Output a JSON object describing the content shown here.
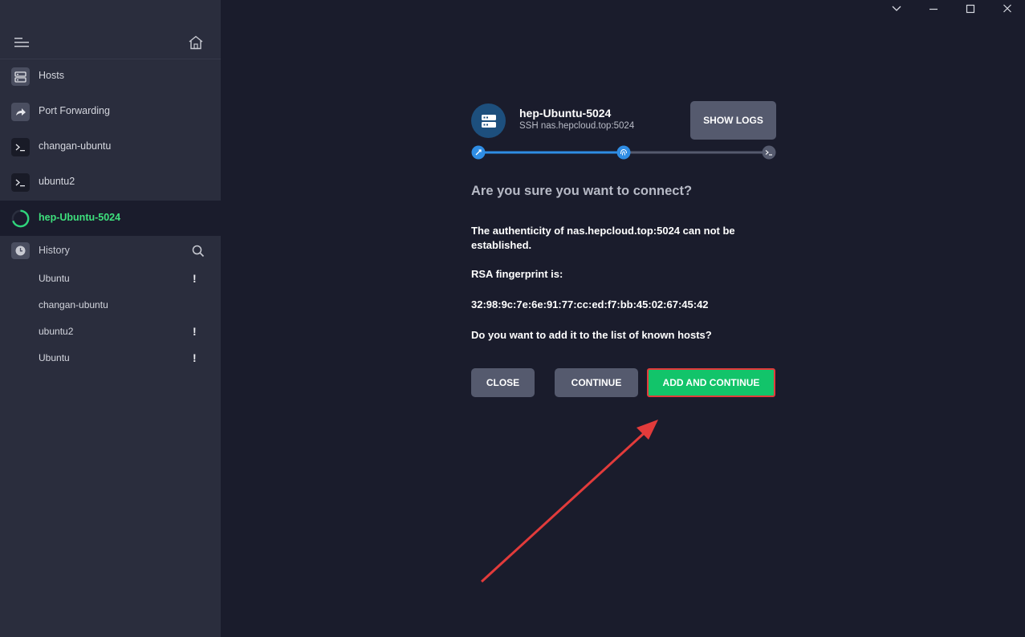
{
  "window": {
    "controls": [
      "chevron-down",
      "minimize",
      "maximize",
      "close"
    ]
  },
  "sidebar": {
    "nav": [
      {
        "label": "Hosts",
        "icon": "hosts-icon"
      },
      {
        "label": "Port Forwarding",
        "icon": "port-forwarding-icon"
      },
      {
        "label": "changan-ubuntu",
        "icon": "terminal-icon"
      },
      {
        "label": "ubuntu2",
        "icon": "terminal-icon"
      },
      {
        "label": "hep-Ubuntu-5024",
        "icon": "connecting-spinner-icon",
        "active": true
      }
    ],
    "history": {
      "label": "History",
      "items": [
        {
          "label": "Ubuntu",
          "warning": "!"
        },
        {
          "label": "changan-ubuntu",
          "warning": ""
        },
        {
          "label": "ubuntu2",
          "warning": "!"
        },
        {
          "label": "Ubuntu",
          "warning": "!"
        }
      ]
    }
  },
  "connection": {
    "host_name": "hep-Ubuntu-5024",
    "host_sub": "SSH nas.hepcloud.top:5024",
    "show_logs": "SHOW LOGS",
    "progress_completed_fraction": 0.5,
    "steps": [
      "connect",
      "fingerprint",
      "terminal"
    ]
  },
  "dialog": {
    "title": "Are you sure you want to connect?",
    "line1": "The authenticity of nas.hepcloud.top:5024 can not be established.",
    "line2": "RSA fingerprint is:",
    "fingerprint": "32:98:9c:7e:6e:91:77:cc:ed:f7:bb:45:02:67:45:42",
    "question": "Do you want to add it to the list of known hosts?",
    "close": "CLOSE",
    "continue": "CONTINUE",
    "add_and_continue": "ADD AND CONTINUE"
  },
  "colors": {
    "accent_blue": "#2f8de4",
    "success_green": "#12c46a",
    "active_text": "#3ee07d",
    "annotation_red": "#e23b3b"
  }
}
